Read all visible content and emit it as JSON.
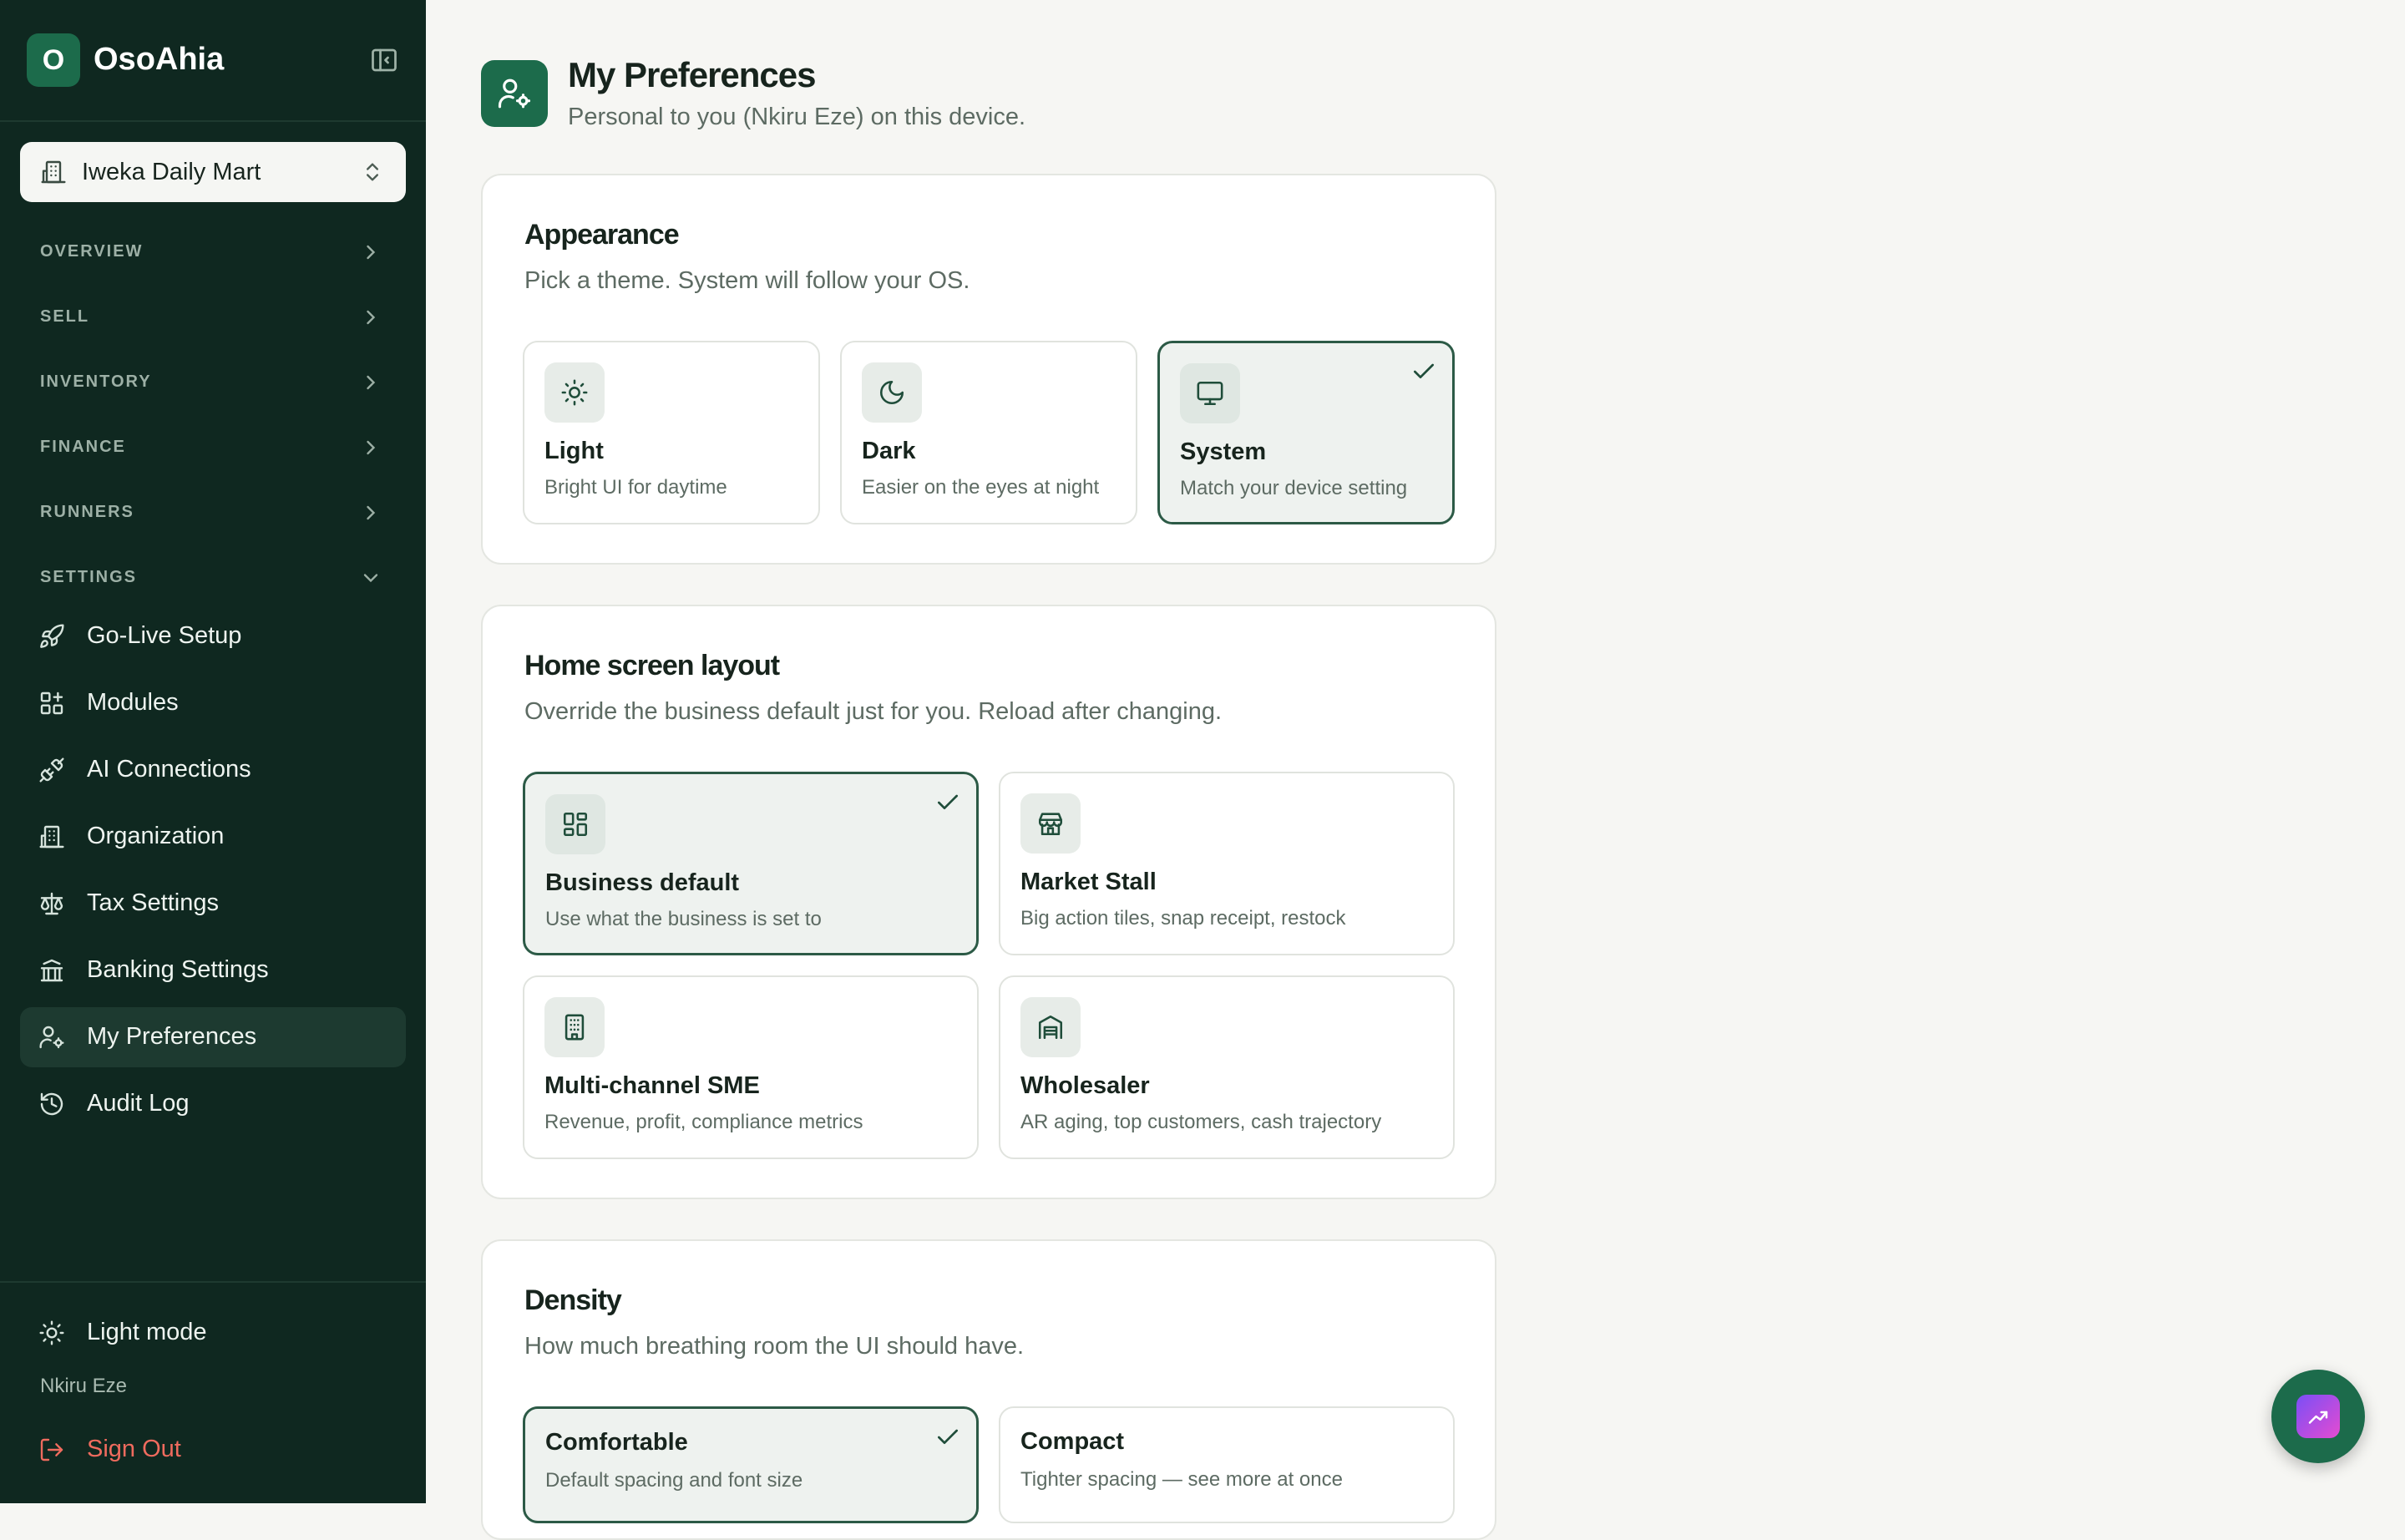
{
  "brand": {
    "initial": "O",
    "name": "OsoAhia"
  },
  "store": {
    "name": "Iweka Daily Mart"
  },
  "sidebar": {
    "sections": [
      {
        "label": "OVERVIEW",
        "expanded": false
      },
      {
        "label": "SELL",
        "expanded": false
      },
      {
        "label": "INVENTORY",
        "expanded": false
      },
      {
        "label": "FINANCE",
        "expanded": false
      },
      {
        "label": "RUNNERS",
        "expanded": false
      },
      {
        "label": "SETTINGS",
        "expanded": true
      }
    ],
    "settings_items": [
      {
        "label": "Go-Live Setup",
        "icon": "rocket-icon"
      },
      {
        "label": "Modules",
        "icon": "modules-icon"
      },
      {
        "label": "AI Connections",
        "icon": "plug-icon"
      },
      {
        "label": "Organization",
        "icon": "building-icon"
      },
      {
        "label": "Tax Settings",
        "icon": "scale-icon"
      },
      {
        "label": "Banking Settings",
        "icon": "bank-icon"
      },
      {
        "label": "My Preferences",
        "icon": "user-cog-icon",
        "active": true
      },
      {
        "label": "Audit Log",
        "icon": "history-icon"
      }
    ],
    "footer": {
      "theme_toggle": "Light mode",
      "user_name": "Nkiru Eze",
      "sign_out": "Sign Out"
    }
  },
  "page": {
    "title": "My Preferences",
    "subtitle": "Personal to you (Nkiru Eze) on this device."
  },
  "appearance": {
    "title": "Appearance",
    "subtitle": "Pick a theme. System will follow your OS.",
    "options": [
      {
        "title": "Light",
        "desc": "Bright UI for daytime",
        "icon": "sun-icon",
        "selected": false
      },
      {
        "title": "Dark",
        "desc": "Easier on the eyes at night",
        "icon": "moon-icon",
        "selected": false
      },
      {
        "title": "System",
        "desc": "Match your device setting",
        "icon": "monitor-icon",
        "selected": true
      }
    ]
  },
  "home_layout": {
    "title": "Home screen layout",
    "subtitle": "Override the business default just for you. Reload after changing.",
    "options": [
      {
        "title": "Business default",
        "desc": "Use what the business is set to",
        "icon": "dashboard-icon",
        "selected": true
      },
      {
        "title": "Market Stall",
        "desc": "Big action tiles, snap receipt, restock",
        "icon": "store-icon",
        "selected": false
      },
      {
        "title": "Multi-channel SME",
        "desc": "Revenue, profit, compliance metrics",
        "icon": "office-icon",
        "selected": false
      },
      {
        "title": "Wholesaler",
        "desc": "AR aging, top customers, cash trajectory",
        "icon": "warehouse-icon",
        "selected": false
      }
    ]
  },
  "density": {
    "title": "Density",
    "subtitle": "How much breathing room the UI should have.",
    "options": [
      {
        "title": "Comfortable",
        "desc": "Default spacing and font size",
        "selected": true
      },
      {
        "title": "Compact",
        "desc": "Tighter spacing — see more at once",
        "selected": false
      }
    ]
  },
  "colors": {
    "sidebar_bg": "#0f2820",
    "accent": "#1c6b4b",
    "sign_out": "#ef6b5e"
  }
}
